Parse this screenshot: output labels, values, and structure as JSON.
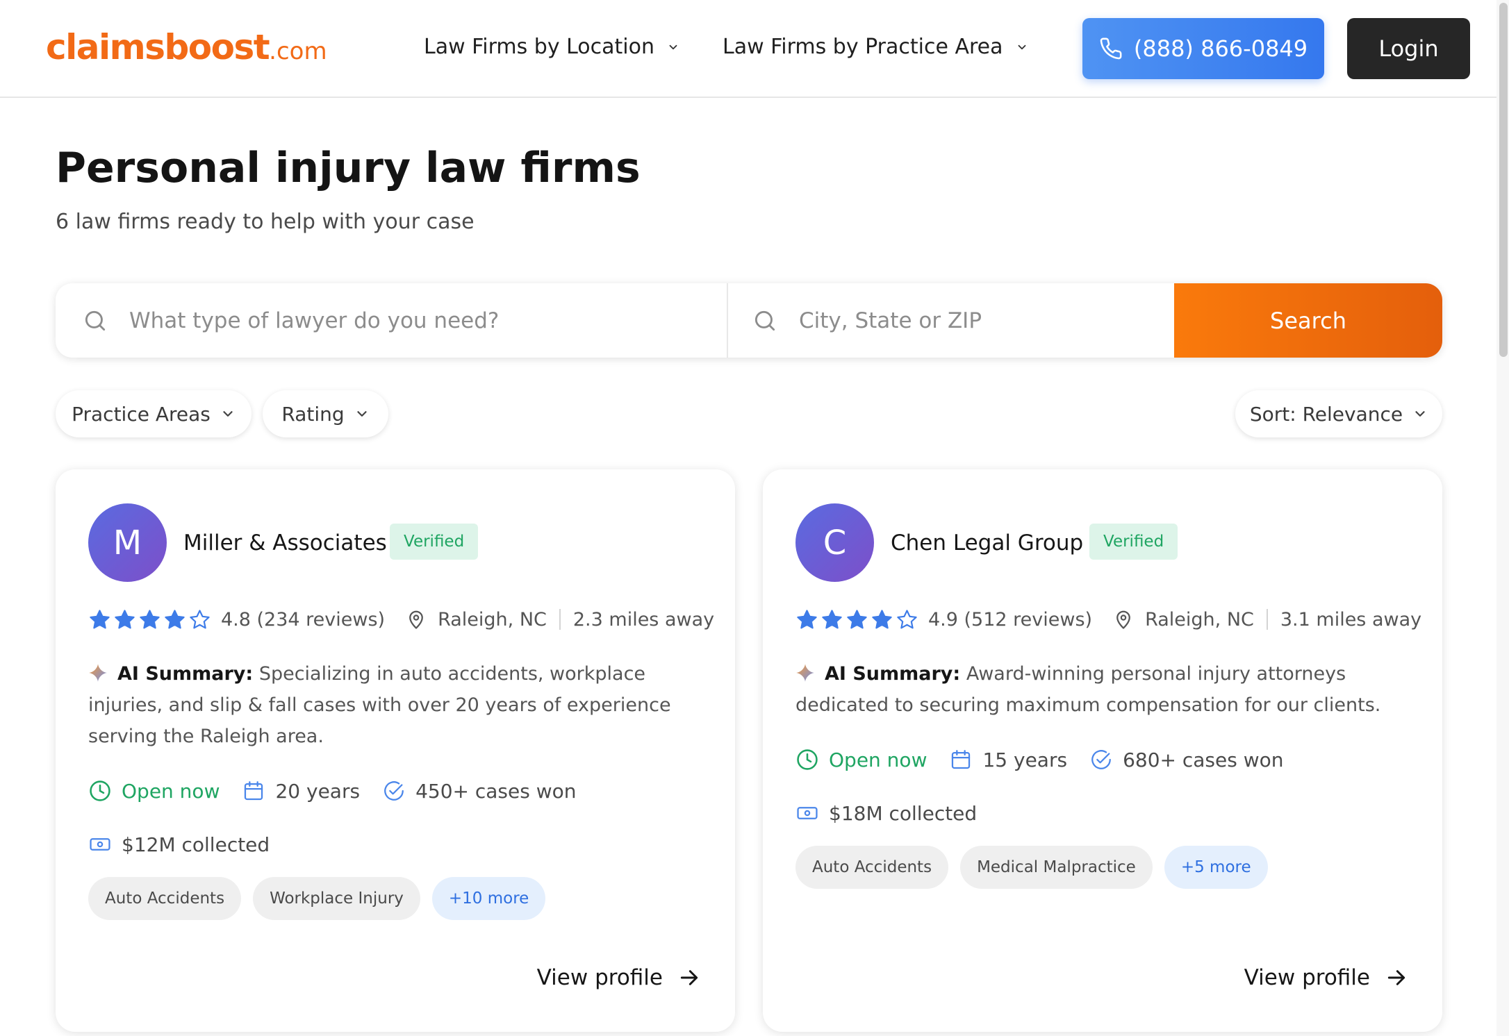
{
  "header": {
    "logo_main": "claimsboost",
    "logo_tld": ".com",
    "nav_location": "Law Firms by Location",
    "nav_practice": "Law Firms by Practice Area",
    "phone": "(888) 866-0849",
    "login": "Login"
  },
  "page": {
    "title": "Personal injury law firms",
    "subtitle": "6 law firms ready to help with your case"
  },
  "search": {
    "what_placeholder": "What type of lawyer do you need?",
    "where_placeholder": "City, State or ZIP",
    "button": "Search"
  },
  "filters": {
    "practice_areas": "Practice Areas",
    "rating": "Rating",
    "sort": "Sort: Relevance"
  },
  "firms": [
    {
      "initial": "M",
      "name": "Miller & Associates",
      "verified": "Verified",
      "stars": 4,
      "rating_text": "4.8 (234 reviews)",
      "location": "Raleigh, NC",
      "distance": "2.3 miles away",
      "summary_label": "AI Summary:",
      "summary": "Specializing in auto accidents, workplace injuries, and slip & fall cases with over 20 years of experience serving the Raleigh area.",
      "open": "Open now",
      "years": "20 years",
      "cases": "450+ cases won",
      "collected": "$12M collected",
      "tags": [
        "Auto Accidents",
        "Workplace Injury"
      ],
      "more": "+10 more",
      "view": "View profile"
    },
    {
      "initial": "C",
      "name": "Chen Legal Group",
      "verified": "Verified",
      "stars": 4,
      "rating_text": "4.9 (512 reviews)",
      "location": "Raleigh, NC",
      "distance": "3.1 miles away",
      "summary_label": "AI Summary:",
      "summary": "Award-winning personal injury attorneys dedicated to securing maximum compensation for our clients.",
      "open": "Open now",
      "years": "15 years",
      "cases": "680+ cases won",
      "collected": "$18M collected",
      "tags": [
        "Auto Accidents",
        "Medical Malpractice"
      ],
      "more": "+5 more",
      "view": "View profile"
    }
  ],
  "colors": {
    "brand_orange": "#f26a16",
    "phone_blue": "#3578ee",
    "star_blue": "#3d7be8",
    "open_green": "#1fa562"
  }
}
